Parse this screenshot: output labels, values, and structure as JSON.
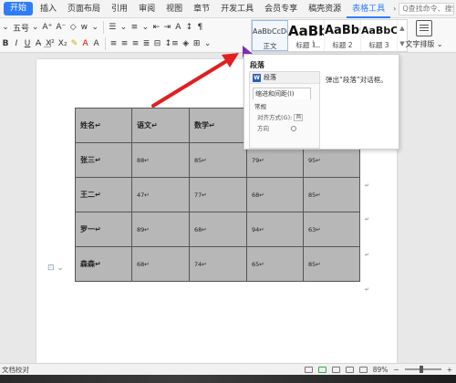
{
  "menu": {
    "tabs": [
      "开始",
      "插入",
      "页面布局",
      "引用",
      "审阅",
      "视图",
      "章节",
      "开发工具",
      "会员专享",
      "稿壳资源",
      "表格工具"
    ],
    "more": "›",
    "search_placeholder": "Q查找命令、搜索模板"
  },
  "ribbon": {
    "font_family": "",
    "font_size": "五号",
    "styles": [
      {
        "sample": "AaBbCcDd",
        "label": "正文"
      },
      {
        "sample": "AaBb",
        "label": "标题 1"
      },
      {
        "sample": "AaBbC",
        "label": "标题 2"
      },
      {
        "sample": "AaBbC",
        "label": "标题 3"
      }
    ],
    "layout_label": "文字排版"
  },
  "table": {
    "rows": [
      [
        "姓名",
        "语文",
        "数学",
        "",
        ""
      ],
      [
        "张三",
        "88",
        "85",
        "79",
        "95"
      ],
      [
        "王二",
        "47",
        "77",
        "68",
        "85"
      ],
      [
        "罗一",
        "89",
        "68",
        "94",
        "63"
      ],
      [
        "森森",
        "68",
        "74",
        "65",
        "85"
      ]
    ]
  },
  "tooltip": {
    "title": "段落",
    "description": "弹出“段落”对话框。",
    "dialog_title": "段落",
    "dialog_tab": "缩进和间距(I)",
    "section": "常规",
    "align_label": "对齐方式(G):",
    "align_value": "两",
    "direction_label": "方向"
  },
  "status": {
    "left": "文档校对",
    "zoom": "89%"
  },
  "colors": {
    "accent": "#2f7df6",
    "table_fill": "#b7b7b7",
    "arrow": "#e02020"
  }
}
